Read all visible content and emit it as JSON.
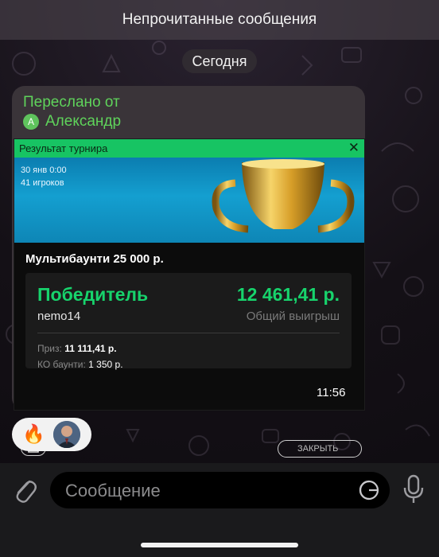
{
  "banner": {
    "unread": "Непрочитанные сообщения"
  },
  "date_divider": "Сегодня",
  "message": {
    "forwarded_label": "Переслано от",
    "author_initial": "A",
    "author": "Александр",
    "time": "11:56"
  },
  "card": {
    "header": "Результат турнира",
    "close_glyph": "✕",
    "date": "30 янв 0:00",
    "players": "41 игроков",
    "tournament": "Мультибаунти 25 000 р.",
    "winner_label": "Победитель",
    "winner_amount": "12 461,41 р.",
    "winner_name": "nemo14",
    "winnings_label": "Общий выигрыш",
    "prize_label": "Приз:",
    "prize_value": "11 111,41 р.",
    "ko_label": "КО баунти:",
    "ko_value": "1 350 р.",
    "close_button": "ЗАКРЫТЬ"
  },
  "reactions": {
    "emoji": "🔥"
  },
  "composer": {
    "placeholder": "Сообщение"
  },
  "colors": {
    "accent_green": "#17c463",
    "forward_green": "#5fd35b",
    "bubble": "#3a3439"
  },
  "icons": [
    "attach-icon",
    "sticker-icon",
    "microphone-icon",
    "share-icon",
    "close-icon",
    "trophy-icon"
  ]
}
